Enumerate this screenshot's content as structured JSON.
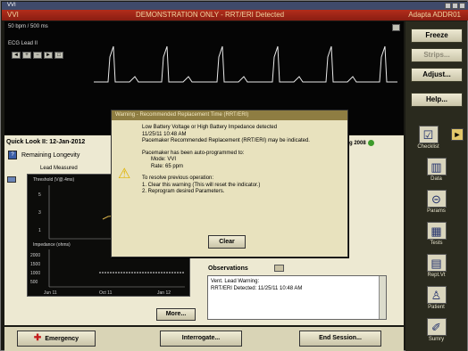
{
  "window": {
    "system_title": "VVI",
    "mode": "VVI",
    "demo_banner": "DEMONSTRATION ONLY - RRT/ERI Detected",
    "brand": "Adapta ADDR01"
  },
  "ecg": {
    "speed_label": "50 bpm / 500 ms",
    "lead_label": "ECG Lead II",
    "mini_buttons": [
      "◄",
      "+",
      "−",
      "►",
      "□"
    ]
  },
  "right_panel": {
    "buttons": [
      {
        "label": "Freeze",
        "enabled": true
      },
      {
        "label": "Strips...",
        "enabled": false
      },
      {
        "label": "Adjust...",
        "enabled": true
      },
      {
        "label": "Help...",
        "enabled": true
      }
    ],
    "icons": [
      {
        "label": "Checklist",
        "icon": "checklist-icon",
        "glyph": "☑"
      },
      {
        "label": "Data",
        "icon": "data-icon",
        "glyph": "▥"
      },
      {
        "label": "Params",
        "icon": "params-icon",
        "glyph": "⊝"
      },
      {
        "label": "Tests",
        "icon": "tests-icon",
        "glyph": "▦"
      },
      {
        "label": "Rept.Vt",
        "icon": "report-icon",
        "glyph": "▤"
      },
      {
        "label": "Patient",
        "icon": "patient-icon",
        "glyph": "♙"
      },
      {
        "label": "Sumry",
        "icon": "summary-icon",
        "glyph": "✐"
      }
    ],
    "arrow": "►"
  },
  "quick_look": {
    "title": "Quick Look II: 12-Jan-2012",
    "right_label": "Aug 2008",
    "remaining_longevity": "Remaining Longevity",
    "lead_measured": "Lead Measured",
    "chart_threshold_label": "Threshold (V@.4ms)",
    "chart_impedance_label": "Impedance (ohms)",
    "y_ticks_top": [
      "5",
      "3",
      "1"
    ],
    "y_ticks_bottom": [
      "2000",
      "1500",
      "1000",
      "500"
    ],
    "x_ticks": [
      "Jun 11",
      "Oct 11",
      "Jan 12"
    ],
    "more_label": "More..."
  },
  "observations": {
    "title": "Observations",
    "lines": [
      "Vent. Lead Warning:",
      "RRT/ERI Detected: 11/25/11 10:48 AM"
    ]
  },
  "bottom": {
    "emergency": "Emergency",
    "interrogate": "Interrogate...",
    "end_session": "End Session..."
  },
  "dialog": {
    "title": "Warning - Recommended Replacement Time (RRT/ERI)",
    "line1": "Low Battery Voltage or High Battery Impedance detected",
    "line2": "11/25/11 10:48 AM",
    "line3": "Pacemaker Recommended Replacement (RRT/ERI) may be indicated.",
    "line4": "Pacemaker has been auto-programmed to:",
    "line5": "Mode: VVI",
    "line6": "Rate: 65 ppm",
    "line7": "To resolve previous operation:",
    "line8": "1. Clear this warning (This will reset the indicator.)",
    "line9": "2. Reprogram desired Parameters.",
    "clear_label": "Clear"
  },
  "colors": {
    "title_red": "#b22d1b",
    "panel_bg": "#ede9d2",
    "dialog_bg": "#e8e2be",
    "emergency_star": "#c41e1e"
  }
}
